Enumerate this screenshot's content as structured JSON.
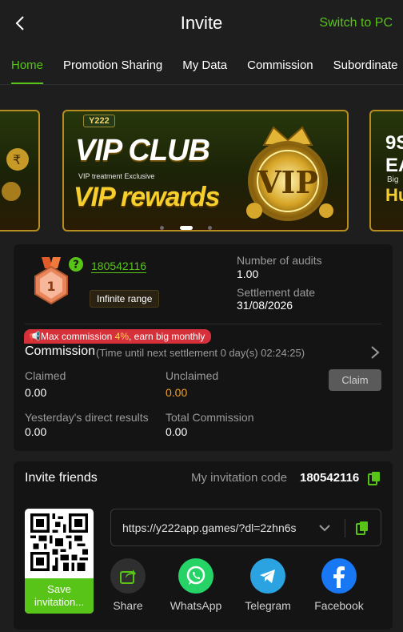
{
  "header": {
    "title": "Invite",
    "switch_label": "Switch to PC"
  },
  "tabs": [
    {
      "label": "Home",
      "active": true
    },
    {
      "label": "Promotion Sharing",
      "active": false
    },
    {
      "label": "My Data",
      "active": false
    },
    {
      "label": "Commission",
      "active": false
    },
    {
      "label": "Subordinate",
      "active": false
    }
  ],
  "banner": {
    "brand": "Y222",
    "title": "VIP CLUB",
    "subtitle": "VIP treatment Exclusive",
    "headline": "VIP rewards",
    "emblem_text": "VIP",
    "right_peek_lines": [
      "9S",
      "EA"
    ],
    "right_peek_sub": "Big",
    "right_peek_headline": "Hug",
    "carousel_dots": 3,
    "carousel_active_index": 1
  },
  "stats": {
    "user_id": "180542116",
    "level": "1",
    "range_badge": "Infinite range",
    "audits_label": "Number of audits",
    "audits_value": "1.00",
    "settlement_label": "Settlement date",
    "settlement_value": "31/08/2026"
  },
  "commission": {
    "promo_prefix": "Max commission ",
    "promo_rate": "4%",
    "promo_suffix": ", earn big monthly",
    "title": "Commission",
    "timer": "(Time until next settlement  0 day(s) 02:24:25)",
    "claimed_label": "Claimed",
    "claimed_value": "0.00",
    "unclaimed_label": "Unclaimed",
    "unclaimed_value": "0.00",
    "claim_button": "Claim",
    "yesterday_label": "Yesterday's direct results",
    "yesterday_value": "0.00",
    "total_label": "Total Commission",
    "total_value": "0.00"
  },
  "invite": {
    "title": "Invite friends",
    "code_label": "My invitation code",
    "code_value": "180542116",
    "save_label": "Save invitation...",
    "link": "https://y222app.games/?dl=2zhn6s",
    "share": [
      {
        "label": "Share",
        "icon": "share-icon",
        "color": "#2f2f2f"
      },
      {
        "label": "WhatsApp",
        "icon": "whatsapp-icon",
        "color": "#25d366"
      },
      {
        "label": "Telegram",
        "icon": "telegram-icon",
        "color": "#2aa3e0"
      },
      {
        "label": "Facebook",
        "icon": "facebook-icon",
        "color": "#1877f2"
      }
    ]
  },
  "colors": {
    "accent": "#58c418",
    "unclaimed": "#f2a12c",
    "promo_badge": "#d6303a"
  }
}
